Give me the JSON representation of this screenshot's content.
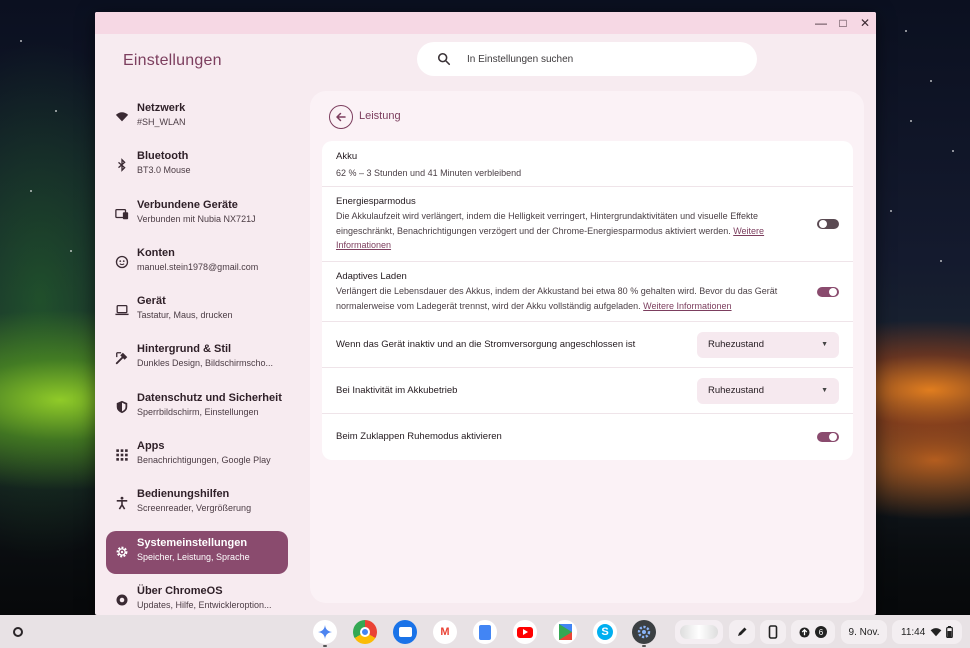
{
  "window": {
    "app_title": "Einstellungen",
    "search_placeholder": "In Einstellungen suchen",
    "min_glyph": "—",
    "max_glyph": "□",
    "close_glyph": "✕"
  },
  "sidebar": {
    "items": [
      {
        "label": "Netzwerk",
        "sub": "#SH_WLAN",
        "icon": "wifi-icon"
      },
      {
        "label": "Bluetooth",
        "sub": "BT3.0 Mouse",
        "icon": "bluetooth-icon"
      },
      {
        "label": "Verbundene Geräte",
        "sub": "Verbunden mit Nubia NX721J",
        "icon": "connected-devices-icon"
      },
      {
        "label": "Konten",
        "sub": "manuel.stein1978@gmail.com",
        "icon": "account-icon"
      },
      {
        "label": "Gerät",
        "sub": "Tastatur, Maus, drucken",
        "icon": "laptop-icon"
      },
      {
        "label": "Hintergrund & Stil",
        "sub": "Dunkles Design, Bildschirmscho...",
        "icon": "palette-icon"
      },
      {
        "label": "Datenschutz und Sicherheit",
        "sub": "Sperrbildschirm, Einstellungen",
        "icon": "shield-icon"
      },
      {
        "label": "Apps",
        "sub": "Benachrichtigungen, Google Play",
        "icon": "apps-grid-icon"
      },
      {
        "label": "Bedienungshilfen",
        "sub": "Screenreader, Vergrößerung",
        "icon": "accessibility-icon"
      },
      {
        "label": "Systemeinstellungen",
        "sub": "Speicher, Leistung, Sprache",
        "icon": "gear-icon"
      },
      {
        "label": "Über ChromeOS",
        "sub": "Updates, Hilfe, Entwickleroption...",
        "icon": "chromeos-icon"
      }
    ],
    "active_index": 9
  },
  "main": {
    "page_title": "Leistung",
    "battery": {
      "title": "Akku",
      "status": "62 % – 3 Stunden und 41 Minuten verbleibend"
    },
    "energy_saver": {
      "title": "Energiesparmodus",
      "desc": "Die Akkulaufzeit wird verlängert, indem die Helligkeit verringert, Hintergrundaktivitäten und visuelle Effekte eingeschränkt, Benachrichtigungen verzögert und der Chrome-Energiesparmodus aktiviert werden. ",
      "link": "Weitere Informationen",
      "enabled": false
    },
    "adaptive_charging": {
      "title": "Adaptives Laden",
      "desc": "Verlängert die Lebensdauer des Akkus, indem der Akkustand bei etwa 80 % gehalten wird. Bevor du das Gerät normalerweise vom Ladegerät trennst, wird der Akku vollständig aufgeladen. ",
      "link": "Weitere Informationen",
      "enabled": true
    },
    "idle_plugged": {
      "label": "Wenn das Gerät inaktiv und an die Stromversorgung angeschlossen ist",
      "value": "Ruhezustand"
    },
    "idle_battery": {
      "label": "Bei Inaktivität im Akkubetrieb",
      "value": "Ruhezustand"
    },
    "lid_close": {
      "label": "Beim Zuklappen Ruhemodus aktivieren",
      "enabled": true
    }
  },
  "shelf": {
    "apps": [
      "gemini-icon",
      "chrome-icon",
      "files-icon",
      "gmail-icon",
      "docs-icon",
      "youtube-icon",
      "play-store-icon",
      "skype-icon",
      "settings-icon"
    ],
    "notification_count": "6",
    "date": "9. Nov.",
    "time": "11:44"
  },
  "colors": {
    "accent": "#7c3e5e",
    "active_nav": "#8a4b6e",
    "window_bg": "#f7ebf0",
    "titlebar": "#f6d8e4"
  }
}
